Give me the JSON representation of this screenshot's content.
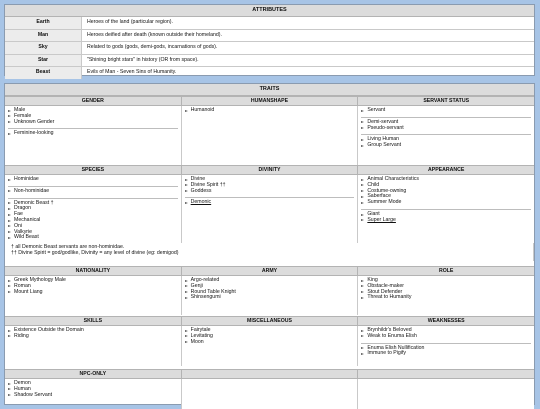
{
  "attributes": {
    "title": "ATTRIBUTES",
    "rows": [
      {
        "name": "Earth",
        "desc": "Heroes of the land (particular region)."
      },
      {
        "name": "Man",
        "desc": "Heroes deified after death (known outside their homeland)."
      },
      {
        "name": "Sky",
        "desc": "Related to gods (gods, demi-gods, incarnations of gods)."
      },
      {
        "name": "Star",
        "desc": "\"Shining bright stars\" in history (OR from space)."
      },
      {
        "name": "Beast",
        "desc": "Evils of Man - Seven Sins of Humanity."
      }
    ]
  },
  "traits": {
    "title": "TRAITS",
    "gender": {
      "header": "GENDER",
      "groups": [
        [
          "Male",
          "Female",
          "Unknown Gender"
        ],
        [
          "Feminine-looking"
        ]
      ]
    },
    "humanshape": {
      "header": "HUMANSHAPE",
      "groups": [
        [
          "Humanoid"
        ]
      ]
    },
    "servant_status": {
      "header": "SERVANT STATUS",
      "groups": [
        [
          "Servant"
        ],
        [
          "Demi-servant",
          "Pseudo-servant"
        ],
        [
          "Living Human",
          "Group Servant"
        ]
      ]
    },
    "species": {
      "header": "SPECIES",
      "groups": [
        [
          "Hominidae"
        ],
        [
          "Non-hominidae"
        ],
        [
          "Demonic Beast †",
          "Dragon",
          "Fae",
          "Mechanical",
          "Oni",
          "Valkyrie",
          "Wild Beast"
        ]
      ]
    },
    "divinity": {
      "header": "DIVINITY",
      "groups": [
        [
          "Divine",
          "Divine Spirit ††",
          "Goddess"
        ],
        [
          "Demonic"
        ]
      ]
    },
    "appearance": {
      "header": "APPEARANCE",
      "groups": [
        [
          "Animal Characteristics",
          "Child",
          "Costume-owning",
          "Saberface",
          "Summer Mode"
        ],
        [
          "Giant",
          "Super Large"
        ]
      ]
    },
    "notes": [
      "† all Demonic Beast servants are non-hominidae.",
      "†† Divine Spirit = god/godlike, Divinity = any level of divine (eg: demigod)"
    ],
    "nationality": {
      "header": "NATIONALITY",
      "groups": [
        [
          "Greek Mythology Male",
          "Roman",
          "Mount Liang"
        ]
      ]
    },
    "army": {
      "header": "ARMY",
      "groups": [
        [
          "Argo-related",
          "Genji",
          "Round Table Knight",
          "Shinsengumi"
        ]
      ]
    },
    "role": {
      "header": "ROLE",
      "groups": [
        [
          "King",
          "Obstacle-maker",
          "Stout Defender",
          "Threat to Humanity"
        ]
      ]
    },
    "skills": {
      "header": "SKILLS",
      "groups": [
        [
          "Existence Outside the Domain",
          "Riding"
        ]
      ]
    },
    "miscellaneous": {
      "header": "MISCELLANEOUS",
      "groups": [
        [
          "Fairytale",
          "Levitating",
          "Moon"
        ]
      ]
    },
    "weaknesses": {
      "header": "WEAKNESSES",
      "groups": [
        [
          "Brynhildr's Beloved",
          "Weak to Enuma Elish"
        ],
        [
          "Enuma Elish Nullification",
          "Immune to Pigify"
        ]
      ]
    },
    "npc_only": {
      "header": "NPC-ONLY",
      "groups": [
        [
          "Demon",
          "Human",
          "Shadow Servant"
        ]
      ]
    }
  }
}
